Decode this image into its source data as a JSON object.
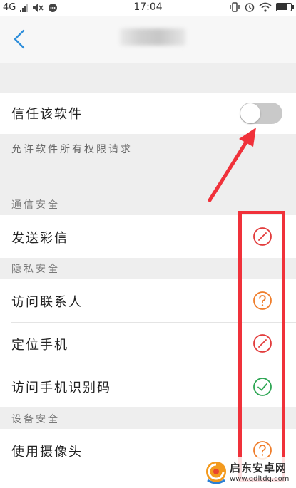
{
  "status_bar": {
    "network": "4G",
    "time": "17:04"
  },
  "permission_page": {
    "trust_label": "信任该软件",
    "trust_enabled": false,
    "trust_hint": "允许软件所有权限请求",
    "sections": [
      {
        "title": "通信安全",
        "items": [
          {
            "label": "发送彩信",
            "state": "forbidden"
          }
        ]
      },
      {
        "title": "隐私安全",
        "items": [
          {
            "label": "访问联系人",
            "state": "ask"
          },
          {
            "label": "定位手机",
            "state": "forbidden"
          },
          {
            "label": "访问手机识别码",
            "state": "allowed"
          }
        ]
      },
      {
        "title": "设备安全",
        "items": [
          {
            "label": "使用摄像头",
            "state": "ask"
          }
        ]
      }
    ]
  },
  "colors": {
    "accent_blue": "#2f8fdb",
    "forbidden_red": "#e23a3a",
    "ask_orange": "#ef7d2a",
    "allowed_green": "#2ea654",
    "annotation_red": "#f0313a"
  },
  "watermark": {
    "name": "启东安卓网",
    "url": "www.qdltdq.com"
  }
}
